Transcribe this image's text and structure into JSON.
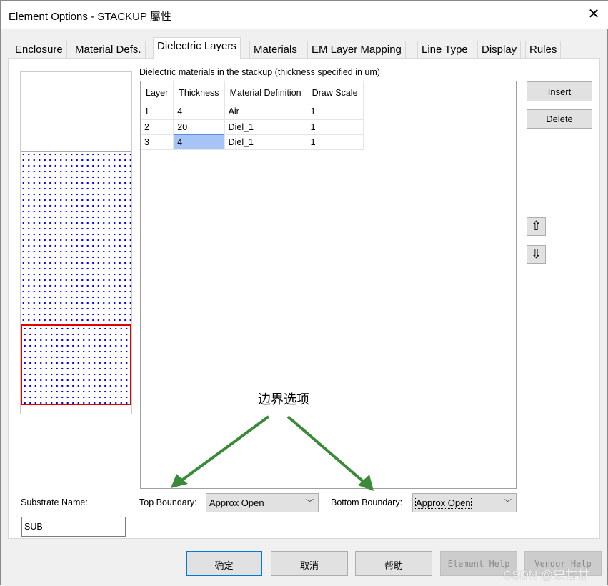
{
  "window": {
    "title": "Element Options - STACKUP 屬性",
    "close_icon": "close-icon"
  },
  "tabs": [
    {
      "label": "Enclosure"
    },
    {
      "label": "Material Defs."
    },
    {
      "label": "Dielectric Layers",
      "active": true
    },
    {
      "label": "Materials"
    },
    {
      "label": "EM Layer Mapping"
    },
    {
      "label": "Line Type"
    },
    {
      "label": "Display"
    },
    {
      "label": "Rules"
    }
  ],
  "main": {
    "table_caption": "Dielectric materials in the stackup (thickness specified in um)",
    "columns": [
      "Layer",
      "Thickness",
      "Material Definition",
      "Draw Scale"
    ],
    "rows": [
      [
        "1",
        "4",
        "Air",
        "1"
      ],
      [
        "2",
        "20",
        "Diel_1",
        "1"
      ],
      [
        "3",
        "4",
        "Diel_1",
        "1"
      ]
    ],
    "selected_cell": {
      "row": 3,
      "column": "Thickness"
    },
    "insert_label": "Insert",
    "delete_label": "Delete",
    "move_up_icon": "arrow-up-icon",
    "move_down_icon": "arrow-down-icon",
    "annotation": "边界选项",
    "annotation_color": "#3a8a3a",
    "substrate_name_label": "Substrate Name:",
    "substrate_name_value": "SUB",
    "top_boundary_label": "Top Boundary:",
    "top_boundary_value": "Approx Open",
    "bottom_boundary_label": "Bottom Boundary:",
    "bottom_boundary_value": "Approx Open"
  },
  "footer": {
    "ok": "确定",
    "cancel": "取消",
    "help": "帮助",
    "element_help": "Element Help",
    "vendor_help": "Vendor Help"
  },
  "watermark": "CSDN @史甘甘",
  "colors": {
    "dielectric_dots": "#0000ff",
    "selected_layer_border": "#e00000",
    "default_button_border": "#0078d7"
  }
}
